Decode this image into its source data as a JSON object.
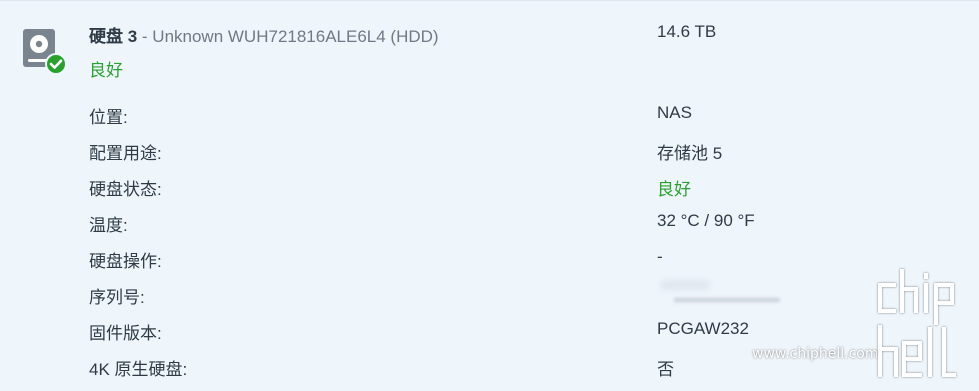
{
  "disk": {
    "name": "硬盘 3",
    "subtitle": " - Unknown WUH721816ALE6L4 (HDD)",
    "capacity": "14.6 TB",
    "health": "良好",
    "icon": "hdd-ok-icon"
  },
  "rows": [
    {
      "label": "位置:",
      "value": "NAS"
    },
    {
      "label": "配置用途:",
      "value": "存储池 5"
    },
    {
      "label": "硬盘状态:",
      "value": "良好"
    },
    {
      "label": "温度:",
      "value": "32 °C / 90 °F"
    },
    {
      "label": "硬盘操作:",
      "value": "-"
    },
    {
      "label": "序列号:",
      "value": ""
    },
    {
      "label": "固件版本:",
      "value": "PCGAW232"
    },
    {
      "label": "4K 原生硬盘:",
      "value": "否"
    }
  ],
  "watermark": {
    "site": "www.chiphell.com",
    "logo_text": "chip hell"
  },
  "colors": {
    "panel_bg": "#eef5fb",
    "text": "#2f3b46",
    "muted": "#6f7a85",
    "good": "#2aa12f"
  }
}
